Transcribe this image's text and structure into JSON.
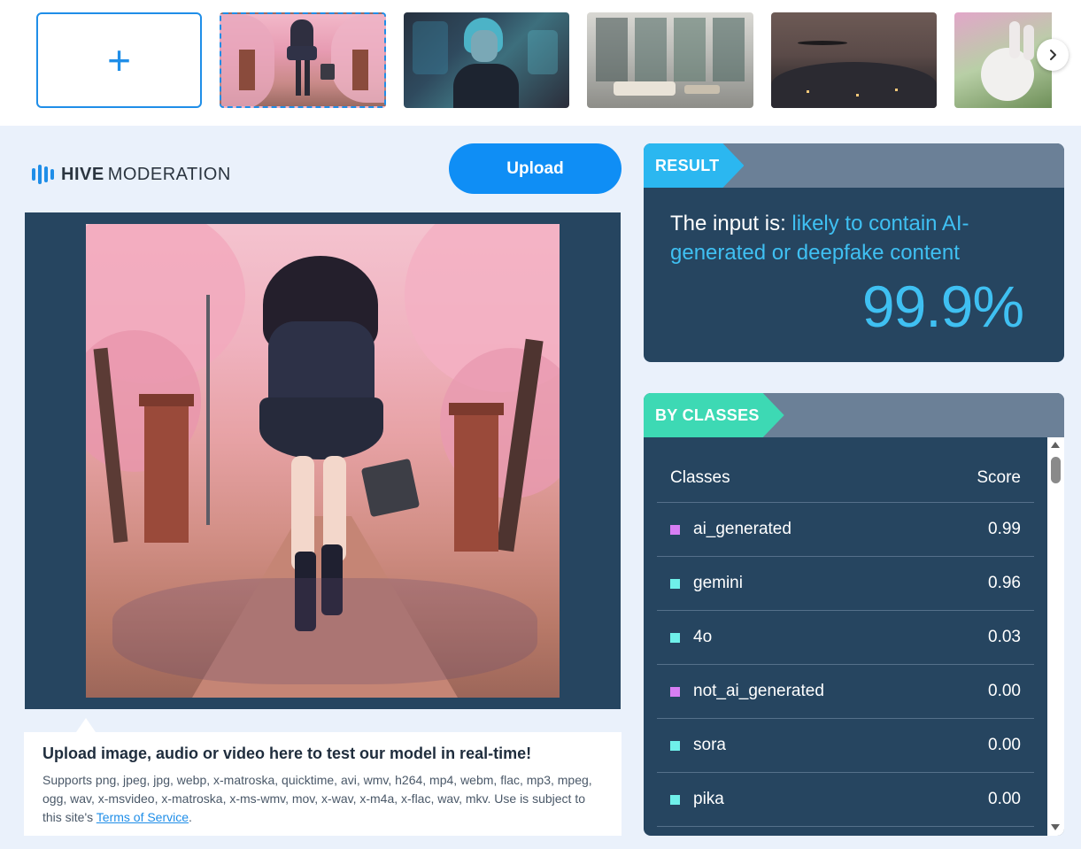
{
  "strip": {
    "add_icon": "plus-icon",
    "next_icon": "chevron-right-icon"
  },
  "logo": {
    "brand_bold": "HIVE",
    "brand_light": "MODERATION",
    "icon": "hive-bars-icon"
  },
  "upload_label": "Upload",
  "result": {
    "header": "RESULT",
    "prefix": "The input is: ",
    "verdict": "likely to contain AI-generated or deepfake content",
    "score": "99.9%"
  },
  "classes": {
    "header": "BY CLASSES",
    "col_class": "Classes",
    "col_score": "Score",
    "rows": [
      {
        "name": "ai_generated",
        "score": "0.99",
        "color": "#d77ef3"
      },
      {
        "name": "gemini",
        "score": "0.96",
        "color": "#6ff0ea"
      },
      {
        "name": "4o",
        "score": "0.03",
        "color": "#6ff0ea"
      },
      {
        "name": "not_ai_generated",
        "score": "0.00",
        "color": "#d77ef3"
      },
      {
        "name": "sora",
        "score": "0.00",
        "color": "#6ff0ea"
      },
      {
        "name": "pika",
        "score": "0.00",
        "color": "#6ff0ea"
      }
    ]
  },
  "info": {
    "title": "Upload image, audio or video here to test our model in real-time!",
    "text": "Supports png, jpeg, jpg, webp, x-matroska, quicktime, avi, wmv, h264, mp4, webm, flac, mp3, mpeg, ogg, wav, x-msvideo, x-matroska, x-ms-wmv, mov, x-wav, x-m4a, x-flac, wav, mkv. Use is subject to this site's ",
    "link": "Terms of Service",
    "end": "."
  },
  "colors": {
    "accent": "#1f8ee8",
    "panel": "#264560",
    "result_blue": "#3fc0f2",
    "classes_teal": "#3dd9b4"
  }
}
